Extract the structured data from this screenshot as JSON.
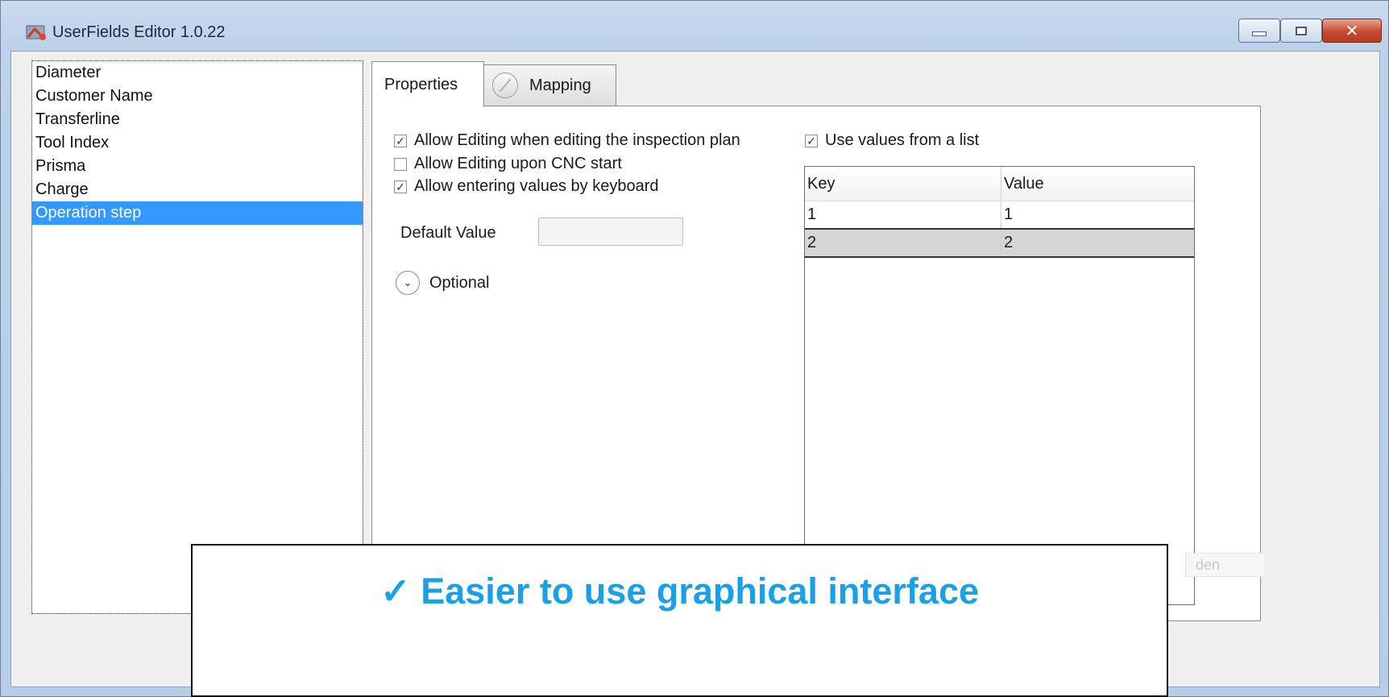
{
  "window": {
    "title": "UserFields Editor 1.0.22",
    "controls": {
      "minimize": "minimize",
      "maximize": "maximize",
      "close": "✕"
    }
  },
  "field_list": {
    "items": [
      {
        "label": "Diameter"
      },
      {
        "label": "Customer Name"
      },
      {
        "label": "Transferline"
      },
      {
        "label": "Tool Index"
      },
      {
        "label": "Prisma"
      },
      {
        "label": "Charge"
      },
      {
        "label": "Operation step",
        "selected": true
      }
    ]
  },
  "tabs": [
    {
      "label": "Properties",
      "active": true
    },
    {
      "label": "Mapping",
      "active": false,
      "icon": "mapping-icon"
    }
  ],
  "properties": {
    "checkboxes": [
      {
        "label": "Allow Editing when editing the inspection plan",
        "checked": true,
        "mark": "✓"
      },
      {
        "label": "Allow Editing upon CNC start",
        "checked": false,
        "mark": ""
      },
      {
        "label": "Allow entering values by keyboard",
        "checked": true,
        "mark": "✓"
      }
    ],
    "default_value": {
      "label": "Default Value",
      "value": ""
    },
    "optional": {
      "label": "Optional",
      "icon": "chevron-down-icon",
      "glyph": "⌄"
    },
    "use_values": {
      "label": "Use values from a list",
      "checked": true,
      "mark": "✓"
    },
    "grid": {
      "columns": [
        "Key",
        "Value"
      ],
      "rows": [
        {
          "key": "1",
          "value": "1"
        },
        {
          "key": "2",
          "value": "2"
        }
      ]
    },
    "ghost_button": "den"
  },
  "callout": {
    "check": "✓",
    "text": "Easier to use graphical interface",
    "color": "#1aa0e6"
  }
}
